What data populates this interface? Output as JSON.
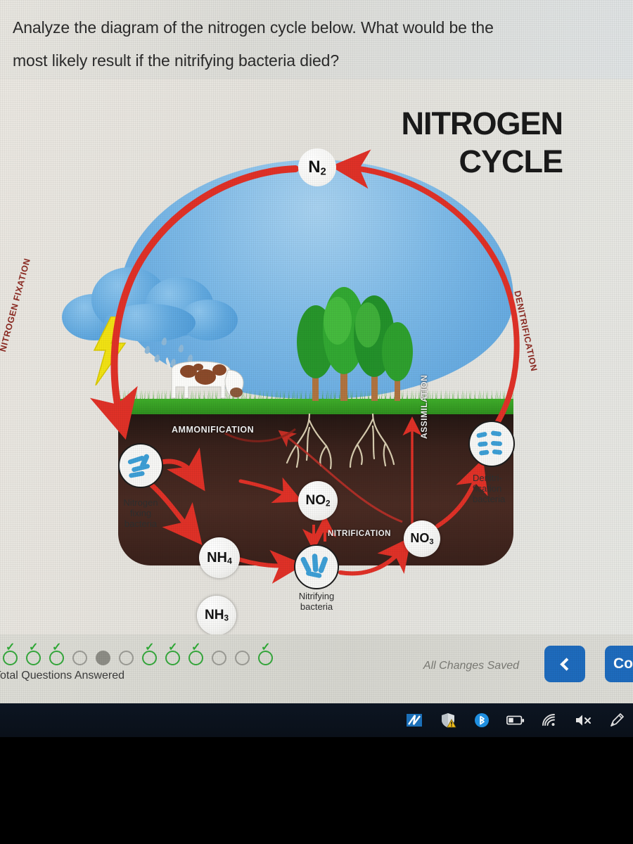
{
  "question": {
    "text": "Analyze the diagram of the nitrogen cycle below. What would be the\nmost likely result if the nitrifying bacteria died?"
  },
  "diagram": {
    "title_line1": "NITROGEN",
    "title_line2": "CYCLE",
    "arc_labels": {
      "left": "NITROGEN FIXATION",
      "right": "DENITRIFICATION"
    },
    "soil_labels": {
      "ammonification": "AMMONIFICATION",
      "nitrification": "NITRIFICATION",
      "assimilation": "ASSIMILATION"
    },
    "molecules": {
      "n2": "N2",
      "nh4": "NH4",
      "nh3": "NH3",
      "no2": "NO2",
      "no3": "NO3"
    },
    "bacteria": {
      "nitrogen_fixing": "Nitrogen\nfixing\nbacteria",
      "denitrification": "Denitri-\nfication\nbacteria",
      "nitrifying": "Nitrifying\nbacteria"
    },
    "colors": {
      "arrow_red": "#e03127",
      "label_dark_red": "#8c2a22",
      "sky_blue": "#6aade2",
      "grass_green": "#3fae2a",
      "soil_brown": "#3a221c",
      "lightning_yellow": "#f2e313",
      "bacteria_blue": "#3d9fd6"
    }
  },
  "footer": {
    "total_questions_label": "Total Questions Answered",
    "saved_status": "All Changes Saved",
    "back_button_icon": "chevron-left-icon",
    "continue_button_label": "Continue",
    "progress": [
      {
        "state": "answered"
      },
      {
        "state": "answered"
      },
      {
        "state": "answered"
      },
      {
        "state": "empty"
      },
      {
        "state": "current"
      },
      {
        "state": "empty"
      },
      {
        "state": "answered"
      },
      {
        "state": "answered"
      },
      {
        "state": "answered"
      },
      {
        "state": "empty"
      },
      {
        "state": "empty"
      },
      {
        "state": "answered"
      }
    ],
    "accent_color": "#1e6bbd"
  },
  "taskbar": {
    "icons": [
      "app-icon",
      "defender-shield-warning-icon",
      "bluetooth-icon",
      "battery-icon",
      "wifi-icon",
      "speaker-muted-icon",
      "stylus-pen-icon"
    ]
  }
}
